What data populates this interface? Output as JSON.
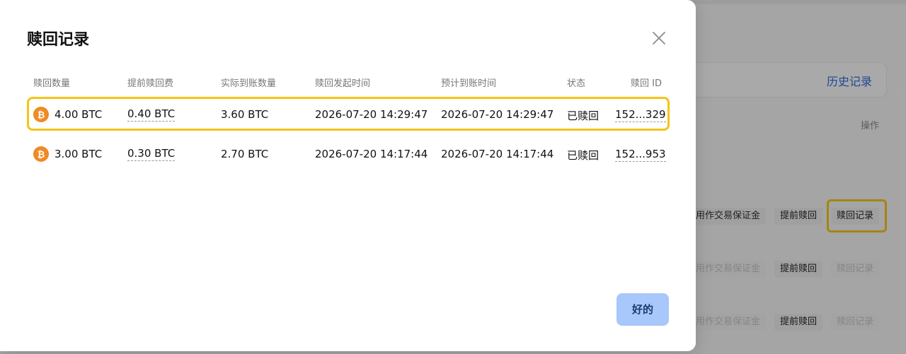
{
  "background": {
    "history_link": "历史记录",
    "ops_header": "操作",
    "rows": [
      {
        "collateral": "用作交易保证金",
        "early": "提前赎回",
        "record": "赎回记录",
        "muted": false
      },
      {
        "collateral": "用作交易保证金",
        "early": "提前赎回",
        "record": "赎回记录",
        "muted": true
      },
      {
        "collateral": "用作交易保证金",
        "early": "提前赎回",
        "record": "赎回记录",
        "muted": true
      }
    ]
  },
  "modal": {
    "title": "赎回记录",
    "ok_label": "好的",
    "columns": [
      "赎回数量",
      "提前赎回费",
      "实际到账数量",
      "赎回发起时间",
      "预计到账时间",
      "状态",
      "赎回 ID"
    ],
    "rows": [
      {
        "amount": "4.00 BTC",
        "fee": "0.40 BTC",
        "received": "3.60 BTC",
        "start_time": "2026-07-20 14:29:47",
        "eta_time": "2026-07-20 14:29:47",
        "status": "已赎回",
        "id": "152...329"
      },
      {
        "amount": "3.00 BTC",
        "fee": "0.30 BTC",
        "received": "2.70 BTC",
        "start_time": "2026-07-20 14:17:44",
        "eta_time": "2026-07-20 14:17:44",
        "status": "已赎回",
        "id": "152...953"
      }
    ]
  },
  "colors": {
    "highlight": "#f5c418",
    "btc": "#f08a24",
    "ok_button": "#a8c7fa",
    "link": "#2f6bdc"
  },
  "icons": {
    "close": "close-icon",
    "coin": "bitcoin-icon"
  }
}
